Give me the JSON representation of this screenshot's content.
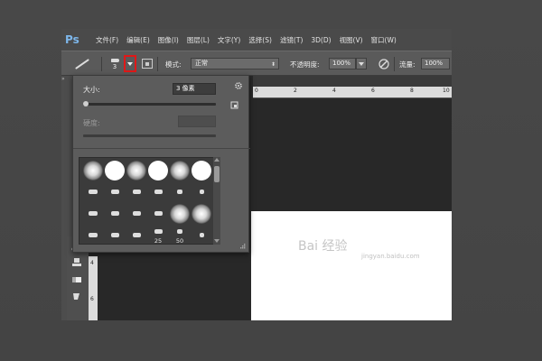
{
  "app": {
    "logo": "Ps"
  },
  "menu": [
    "文件(F)",
    "编辑(E)",
    "图像(I)",
    "图层(L)",
    "文字(Y)",
    "选择(S)",
    "滤镜(T)",
    "3D(D)",
    "视图(V)",
    "窗口(W)"
  ],
  "options_bar": {
    "brush_size": "3",
    "mode_label": "模式:",
    "mode_value": "正常",
    "opacity_label": "不透明度:",
    "opacity_value": "100%",
    "flow_label": "流量:",
    "flow_value": "100%"
  },
  "brush_panel": {
    "size_label": "大小:",
    "size_value": "3 像素",
    "size_slider_fraction": 0.01,
    "hardness_label": "硬度:",
    "hardness_value": "",
    "presets": [
      {
        "shape": "soft",
        "caption": ""
      },
      {
        "shape": "hard",
        "caption": ""
      },
      {
        "shape": "soft",
        "caption": ""
      },
      {
        "shape": "hard",
        "caption": ""
      },
      {
        "shape": "soft",
        "caption": ""
      },
      {
        "shape": "hard",
        "caption": ""
      },
      {
        "shape": "small",
        "caption": ""
      },
      {
        "shape": "small",
        "caption": ""
      },
      {
        "shape": "small",
        "caption": ""
      },
      {
        "shape": "small",
        "caption": ""
      },
      {
        "shape": "small",
        "caption": ""
      },
      {
        "shape": "small",
        "caption": ""
      },
      {
        "shape": "small",
        "caption": ""
      },
      {
        "shape": "small",
        "caption": ""
      },
      {
        "shape": "small",
        "caption": ""
      },
      {
        "shape": "small",
        "caption": ""
      },
      {
        "shape": "soft",
        "caption": ""
      },
      {
        "shape": "soft",
        "caption": ""
      },
      {
        "shape": "small",
        "caption": ""
      },
      {
        "shape": "small",
        "caption": ""
      },
      {
        "shape": "small",
        "caption": ""
      },
      {
        "shape": "small",
        "caption": "25"
      },
      {
        "shape": "small",
        "caption": "50"
      },
      {
        "shape": "small",
        "caption": ""
      }
    ]
  },
  "rulers": {
    "top_ticks": [
      "0",
      "2",
      "4",
      "6",
      "8",
      "10"
    ],
    "left_ticks": [
      "4",
      "6"
    ]
  },
  "watermark": {
    "main": "Bai 经验",
    "sub": "jingyan.baidu.com"
  },
  "colors": {
    "highlight": "#e01818",
    "canvas": "#ffffff",
    "workspace": "#282828"
  }
}
